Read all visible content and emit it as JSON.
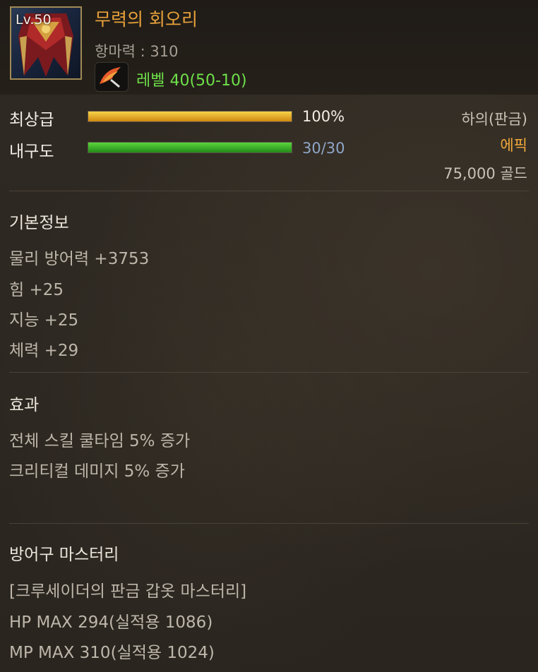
{
  "item": {
    "level_badge": "Lv.50",
    "name": "무력의 회오리",
    "magic_resist": "항마력 : 310",
    "level_requirement": "레벨 40(50-10)"
  },
  "bars": {
    "grade_label": "최상급",
    "grade_value_text": "100%",
    "grade_fraction": 1.0,
    "durability_label": "내구도",
    "durability_value_text": "30/30",
    "durability_fraction": 1.0
  },
  "meta": {
    "slot": "하의(판금)",
    "rarity": "에픽",
    "price": "75,000 골드"
  },
  "basic_info": {
    "title": "기본정보",
    "lines": [
      "물리 방어력 +3753",
      "힘 +25",
      "지능 +25",
      "체력 +29"
    ]
  },
  "effects": {
    "title": "효과",
    "lines": [
      "전체 스킬 쿨타임 5% 증가",
      "크리티컬 데미지 5% 증가"
    ]
  },
  "mastery": {
    "title": "방어구 마스터리",
    "lines": [
      "[크루세이더의 판금 갑옷 마스터리]",
      "HP MAX 294(실적용 1086)",
      "MP MAX 310(실적용 1024)"
    ]
  },
  "colors": {
    "name": "#e8a13a",
    "level_req": "#6ee04a",
    "rarity": "#f0a93a",
    "grade_bar": "#e0a020",
    "durability_bar": "#3fb52a"
  },
  "icons": {
    "item": "armor-cape-icon",
    "level": "wing-quill-icon"
  }
}
